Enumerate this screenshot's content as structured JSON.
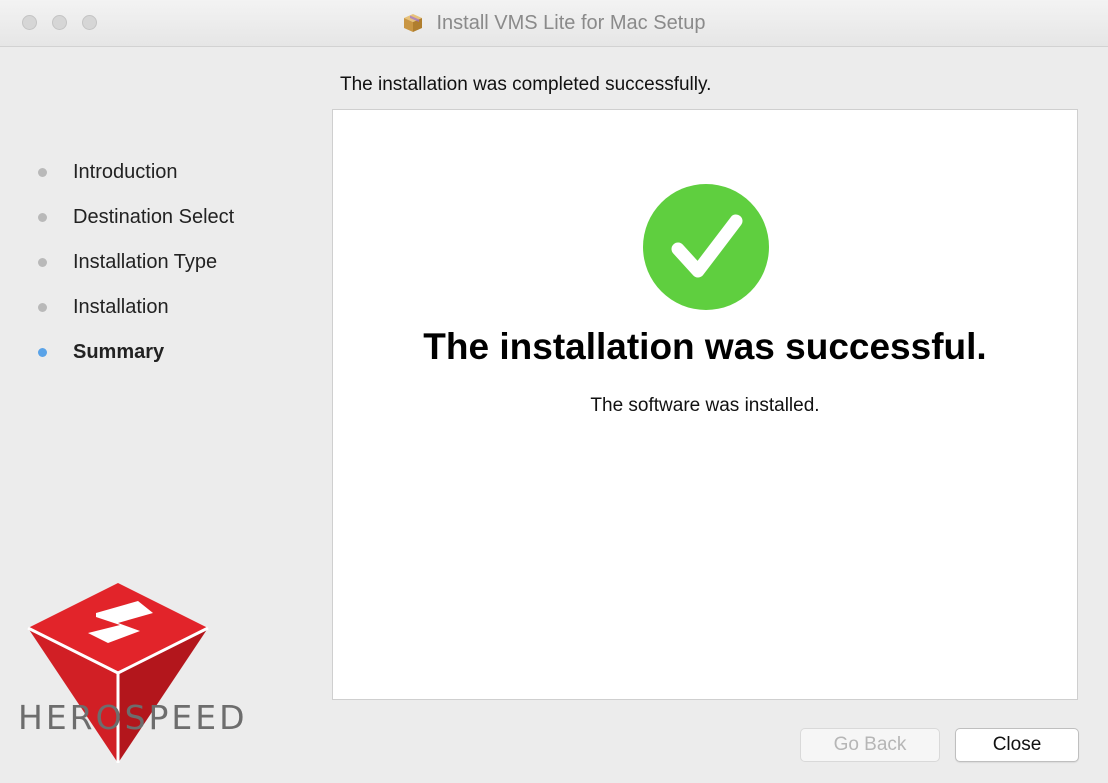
{
  "window": {
    "title": "Install VMS Lite for Mac Setup",
    "title_icon": "package-icon"
  },
  "header": {
    "status_text": "The installation was completed successfully."
  },
  "sidebar": {
    "steps": [
      {
        "label": "Introduction",
        "active": false
      },
      {
        "label": "Destination Select",
        "active": false
      },
      {
        "label": "Installation Type",
        "active": false
      },
      {
        "label": "Installation",
        "active": false
      },
      {
        "label": "Summary",
        "active": true
      }
    ]
  },
  "main": {
    "icon": "checkmark-success-icon",
    "title": "The installation was successful.",
    "subtitle": "The software was installed."
  },
  "buttons": {
    "back_label": "Go Back",
    "back_enabled": false,
    "close_label": "Close"
  },
  "brand": {
    "logo_text": "HEROSPEED",
    "logo_icon": "herospeed-logo",
    "logo_color": "#e2242a"
  },
  "colors": {
    "success_green": "#5fcf3f",
    "active_step": "#5aa3e8"
  }
}
